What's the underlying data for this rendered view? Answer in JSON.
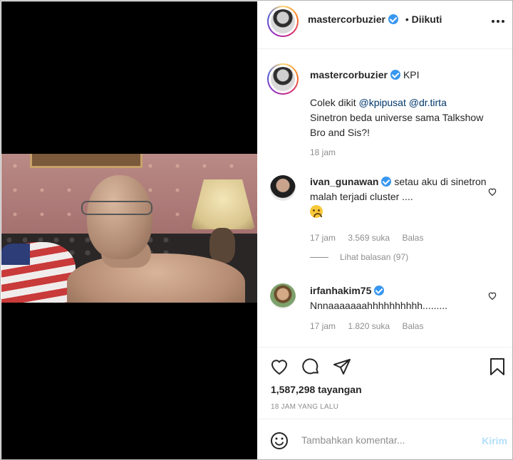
{
  "post": {
    "username": "mastercorbuzier",
    "dot": "•",
    "follow_status": "Diikuti"
  },
  "caption": {
    "username": "mastercorbuzier",
    "tag": "KPI",
    "text_prefix": "Colek dikit",
    "mention1": "@kpipusat",
    "mention2": "@dr.tirta",
    "line2": "Sinetron beda universe sama Talkshow",
    "line3": "Bro and Sis?!",
    "time": "18 jam"
  },
  "comments": [
    {
      "username": "ivan_gunawan",
      "text": "setau aku di sinetron malah terjadi cluster ....",
      "time": "17 jam",
      "likes": "3.569 suka",
      "reply": "Balas",
      "replies_label": "Lihat balasan (97)"
    },
    {
      "username": "irfanhakim75",
      "text": "Nnnaaaaaaahhhhhhhhhh.........",
      "time": "17 jam",
      "likes": "1.820 suka",
      "reply": "Balas"
    }
  ],
  "stats": {
    "views": "1,587,298 tayangan",
    "posted": "18 JAM YANG LALU"
  },
  "add_comment": {
    "placeholder": "Tambahkan komentar...",
    "post_label": "Kirim"
  },
  "colors": {
    "verified": "#3897f0",
    "mention": "#00376b",
    "muted": "#8e8e8e",
    "post_button_disabled": "#b2dffc"
  }
}
